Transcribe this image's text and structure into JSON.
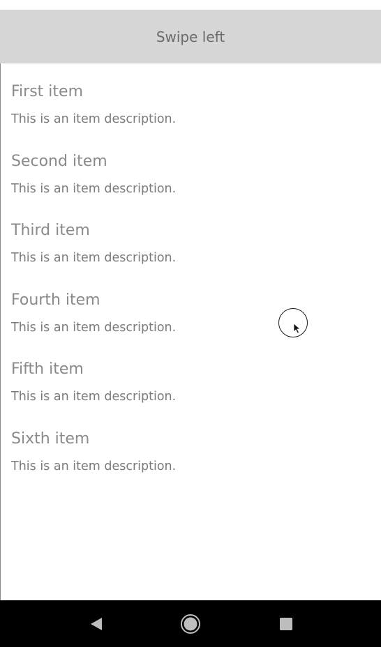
{
  "banner": {
    "text": "Swipe left"
  },
  "items": [
    {
      "title": "First item",
      "description": "This is an item description."
    },
    {
      "title": "Second item",
      "description": "This is an item description."
    },
    {
      "title": "Third item",
      "description": "This is an item description."
    },
    {
      "title": "Fourth item",
      "description": "This is an item description."
    },
    {
      "title": "Fifth item",
      "description": "This is an item description."
    },
    {
      "title": "Sixth item",
      "description": "This is an item description."
    }
  ],
  "nav": {
    "back_icon": "back-triangle-icon",
    "home_icon": "home-circle-icon",
    "recents_icon": "recents-square-icon"
  },
  "colors": {
    "banner_bg": "#d6d6d6",
    "nav_bg": "#000000",
    "text_gray": "#8a8a8a"
  }
}
